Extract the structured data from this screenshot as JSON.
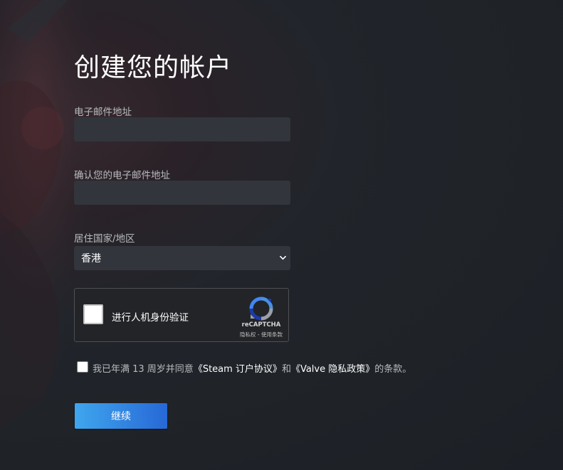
{
  "page": {
    "title": "创建您的帐户"
  },
  "form": {
    "email_label": "电子邮件地址",
    "email_value": "",
    "confirm_email_label": "确认您的电子邮件地址",
    "confirm_email_value": "",
    "country_label": "居住国家/地区",
    "country_selected": "香港"
  },
  "captcha": {
    "label": "进行人机身份验证",
    "brand": "reCAPTCHA",
    "links": "隐私权 - 使用条款",
    "icon": "recaptcha-logo"
  },
  "agreement": {
    "prefix": "我已年满 13 周岁并同意",
    "steam_link": "《Steam 订户协议》",
    "and": "和",
    "valve_link": "《Valve 隐私政策》",
    "suffix": "的条款。",
    "checked": false
  },
  "actions": {
    "continue_label": "继续"
  },
  "colors": {
    "background": "#1f2328",
    "input_bg": "#32353c",
    "label": "#b8bcbf",
    "button_start": "#3fa6ee",
    "button_end": "#2768d6"
  }
}
